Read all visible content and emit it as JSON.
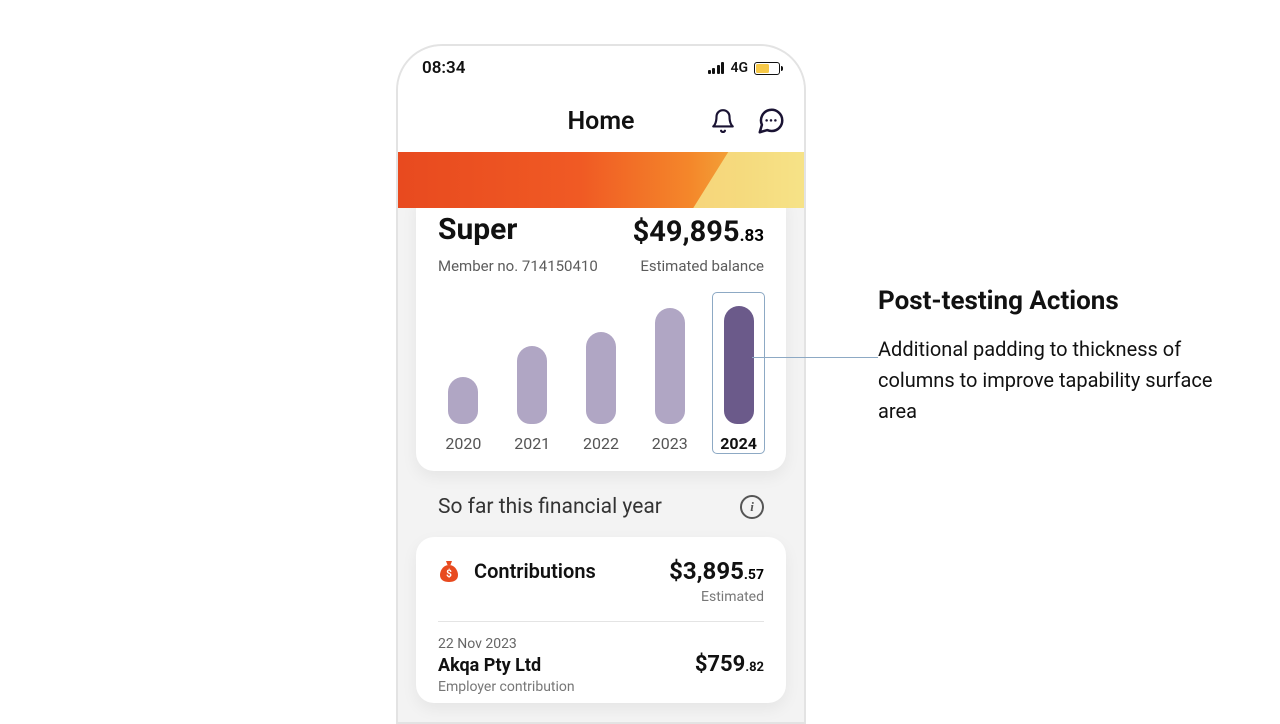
{
  "status": {
    "time": "08:34",
    "network": "4G"
  },
  "nav": {
    "title": "Home"
  },
  "super_card": {
    "title": "Super",
    "balance_main": "$49,895",
    "balance_cents": ".83",
    "member_label": "Member no. 714150410",
    "balance_label": "Estimated balance"
  },
  "chart_data": {
    "type": "bar",
    "categories": [
      "2020",
      "2021",
      "2022",
      "2023",
      "2024"
    ],
    "values": [
      40,
      66,
      78,
      98,
      100
    ],
    "selected_index": 4,
    "title": "",
    "xlabel": "",
    "ylabel": "",
    "ylim": [
      0,
      100
    ]
  },
  "section": {
    "heading": "So far this financial year"
  },
  "contributions": {
    "title": "Contributions",
    "amount_main": "$3,895",
    "amount_cents": ".57",
    "estimated_label": "Estimated",
    "txn": {
      "date": "22 Nov 2023",
      "name": "Akqa Pty Ltd",
      "type": "Employer contribution",
      "amount_main": "$759",
      "amount_cents": ".82"
    }
  },
  "callout": {
    "title": "Post-testing Actions",
    "body": "Additional padding to thickness of columns to improve tapability surface area"
  }
}
